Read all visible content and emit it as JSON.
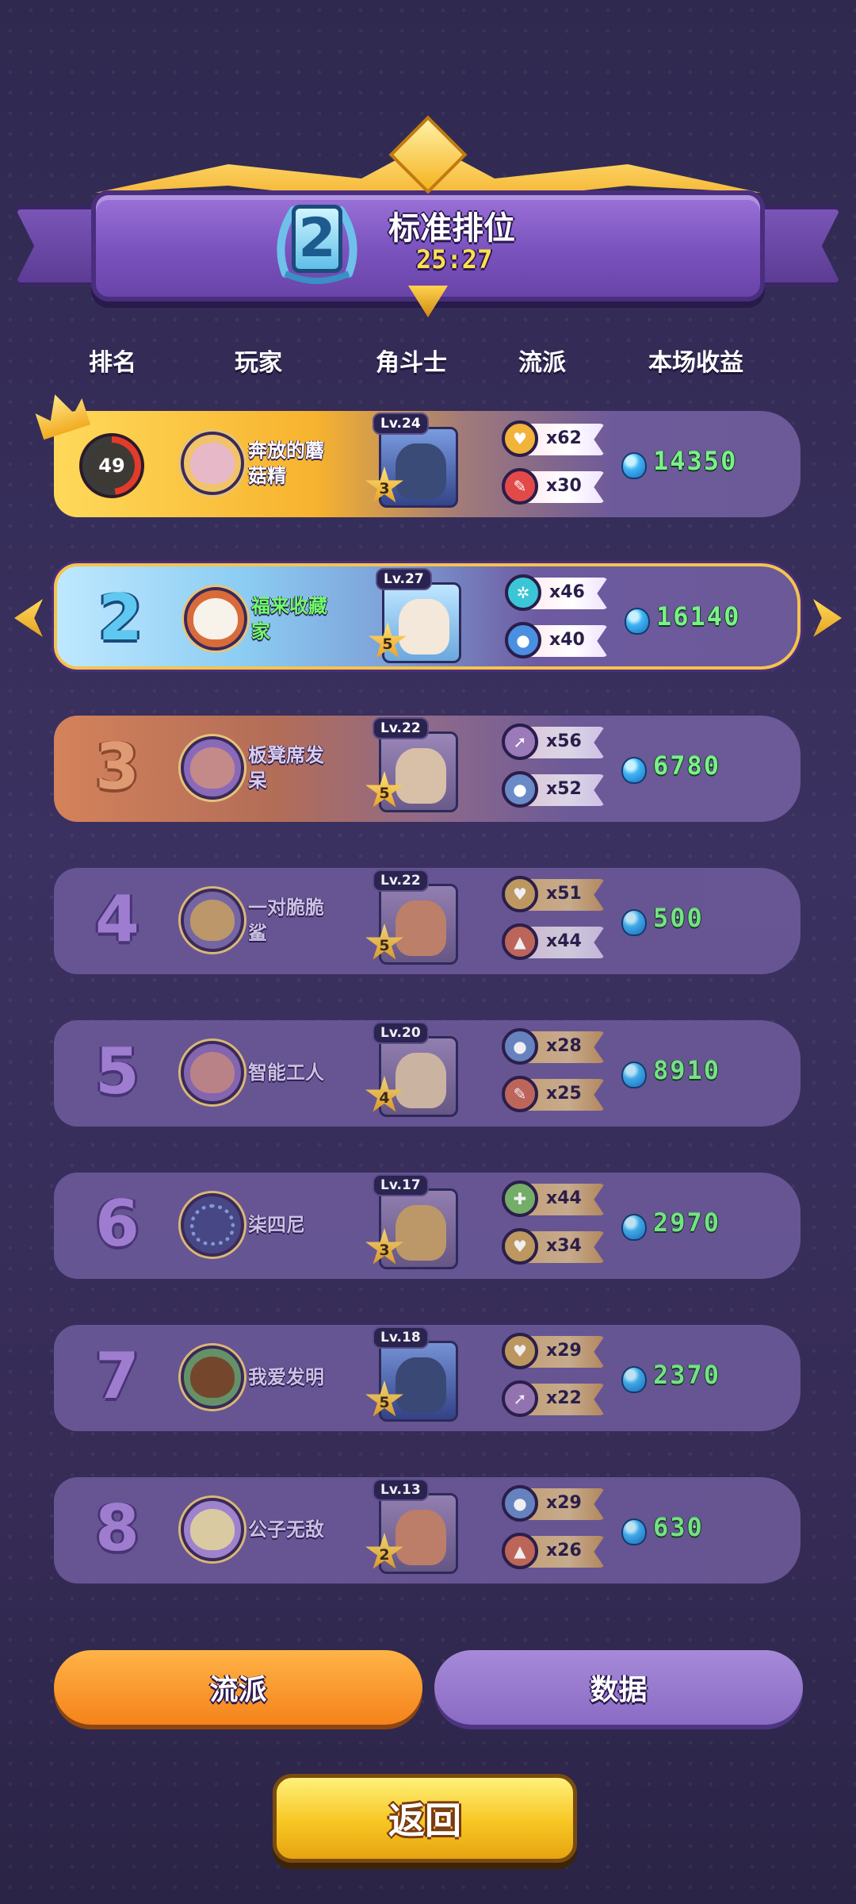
{
  "header": {
    "rank": "2",
    "title": "标准排位",
    "time": "25:27"
  },
  "columns": {
    "rank": "排名",
    "player": "玩家",
    "gladiator": "角斗士",
    "faction": "流派",
    "earnings": "本场收益"
  },
  "rows": [
    {
      "rank": "",
      "health": "49",
      "name": "奔放的蘑菇精",
      "name_lines": [
        "奔放的蘑",
        "菇精"
      ],
      "level": "Lv.24",
      "stars": "3",
      "traits": [
        {
          "icon": "heart-icon",
          "count": "x62"
        },
        {
          "icon": "feather-icon",
          "count": "x30"
        }
      ],
      "earnings": "14350"
    },
    {
      "rank": "2",
      "name": "福来收藏家",
      "name_lines": [
        "福来收藏",
        "家"
      ],
      "level": "Lv.27",
      "stars": "5",
      "traits": [
        {
          "icon": "snowflake-icon",
          "count": "x46"
        },
        {
          "icon": "drop-icon",
          "count": "x40"
        }
      ],
      "earnings": "16140"
    },
    {
      "rank": "3",
      "name": "板凳席发呆",
      "name_lines": [
        "板凳席发",
        "呆"
      ],
      "level": "Lv.22",
      "stars": "5",
      "traits": [
        {
          "icon": "rocket-icon",
          "count": "x56"
        },
        {
          "icon": "drop-icon",
          "count": "x52"
        }
      ],
      "earnings": "6780"
    },
    {
      "rank": "4",
      "name": "一对脆脆鲨",
      "name_lines": [
        "一对脆脆",
        "鲨"
      ],
      "level": "Lv.22",
      "stars": "5",
      "traits": [
        {
          "icon": "heart-icon",
          "count": "x51"
        },
        {
          "icon": "fire-icon",
          "count": "x44"
        }
      ],
      "earnings": "500"
    },
    {
      "rank": "5",
      "name": "智能工人",
      "name_lines": [
        "智能工人"
      ],
      "level": "Lv.20",
      "stars": "4",
      "traits": [
        {
          "icon": "drop-icon",
          "count": "x28"
        },
        {
          "icon": "feather-icon",
          "count": "x25"
        }
      ],
      "earnings": "8910"
    },
    {
      "rank": "6",
      "name": "柒四尼",
      "name_lines": [
        "柒四尼"
      ],
      "level": "Lv.17",
      "stars": "3",
      "traits": [
        {
          "icon": "plus-icon",
          "count": "x44"
        },
        {
          "icon": "heart-icon",
          "count": "x34"
        }
      ],
      "earnings": "2970"
    },
    {
      "rank": "7",
      "name": "我爱发明",
      "name_lines": [
        "我爱发明"
      ],
      "level": "Lv.18",
      "stars": "5",
      "traits": [
        {
          "icon": "heart-icon",
          "count": "x29"
        },
        {
          "icon": "rocket-icon",
          "count": "x22"
        }
      ],
      "earnings": "2370"
    },
    {
      "rank": "8",
      "name": "公子无敌",
      "name_lines": [
        "公子无敌"
      ],
      "level": "Lv.13",
      "stars": "2",
      "traits": [
        {
          "icon": "drop-icon",
          "count": "x29"
        },
        {
          "icon": "fire-icon",
          "count": "x26"
        }
      ],
      "earnings": "630"
    }
  ],
  "tabs": {
    "faction": "流派",
    "data": "数据"
  },
  "back_button": "返回",
  "colors": {
    "earnings": "#7cf08a",
    "highlight_name": "#6fff6a",
    "active_tab": "#f5831b",
    "inactive_tab": "#8a6bc4",
    "back_button": "#f7c623"
  }
}
